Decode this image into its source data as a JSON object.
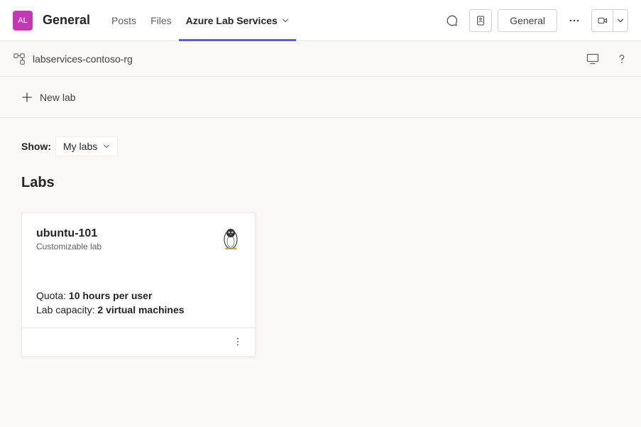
{
  "header": {
    "avatar_initials": "AL",
    "channel_name": "General",
    "tabs": [
      {
        "label": "Posts",
        "active": false
      },
      {
        "label": "Files",
        "active": false
      },
      {
        "label": "Azure Lab Services",
        "active": true,
        "has_chevron": true
      }
    ],
    "general_button": "General"
  },
  "subheader": {
    "resource_group": "labservices-contoso-rg"
  },
  "toolbar": {
    "new_lab_label": "New lab"
  },
  "filter": {
    "label": "Show:",
    "selected": "My labs"
  },
  "section": {
    "title": "Labs"
  },
  "lab_card": {
    "name": "ubuntu-101",
    "subtitle": "Customizable lab",
    "quota_label": "Quota: ",
    "quota_value": "10 hours per user",
    "capacity_label": "Lab capacity: ",
    "capacity_value": "2 virtual machines"
  }
}
